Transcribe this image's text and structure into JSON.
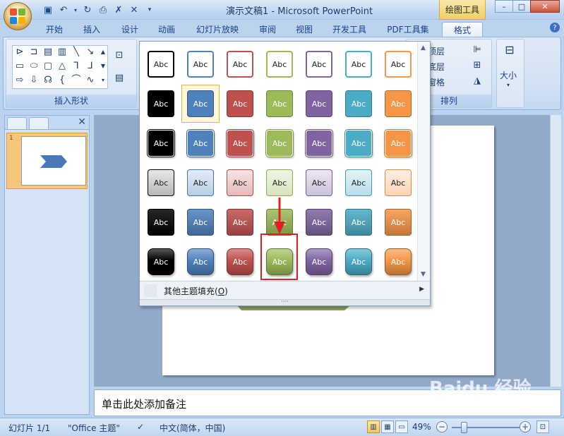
{
  "app": {
    "title": "演示文稿1 - Microsoft PowerPoint",
    "context_tool": "绘图工具",
    "window_controls": [
      "–",
      "□",
      "✕"
    ],
    "help": "?"
  },
  "tabs": [
    {
      "label": "开始",
      "active": false
    },
    {
      "label": "插入",
      "active": false
    },
    {
      "label": "设计",
      "active": false
    },
    {
      "label": "动画",
      "active": false
    },
    {
      "label": "幻灯片放映",
      "active": false
    },
    {
      "label": "审阅",
      "active": false
    },
    {
      "label": "视图",
      "active": false
    },
    {
      "label": "开发工具",
      "active": false
    },
    {
      "label": "PDF工具集",
      "active": false
    },
    {
      "label": "格式",
      "active": true
    }
  ],
  "ribbon": {
    "insert_shapes_label": "插入形状",
    "arrange_label": "排列",
    "bring_to_front": "置于顶层",
    "send_to_back": "置于底层",
    "selection_pane": "选择窗格",
    "size_label": "大小"
  },
  "gallery": {
    "swatch_text": "Abc",
    "footer_label": "其他主题填充(O)",
    "footer_prefix": "其他主题填充(",
    "footer_key": "O",
    "footer_suffix": ")",
    "grip": "····",
    "columns": [
      "#000000",
      "#4f81bd",
      "#c0504d",
      "#9bbb59",
      "#8064a2",
      "#4bacc6",
      "#f79646"
    ],
    "selected": {
      "row": 1,
      "col": 1
    },
    "highlighted": {
      "row": 5,
      "col": 3
    }
  },
  "slides_panel": {
    "slide_number": "1"
  },
  "notes": {
    "placeholder": "单击此处添加备注"
  },
  "statusbar": {
    "slide_info": "幻灯片 1/1",
    "theme": "\"Office 主题\"",
    "language": "中文(简体，中国)",
    "zoom": "49%",
    "zoom_fraction": 0.49
  },
  "watermark": "Baidu 经验"
}
